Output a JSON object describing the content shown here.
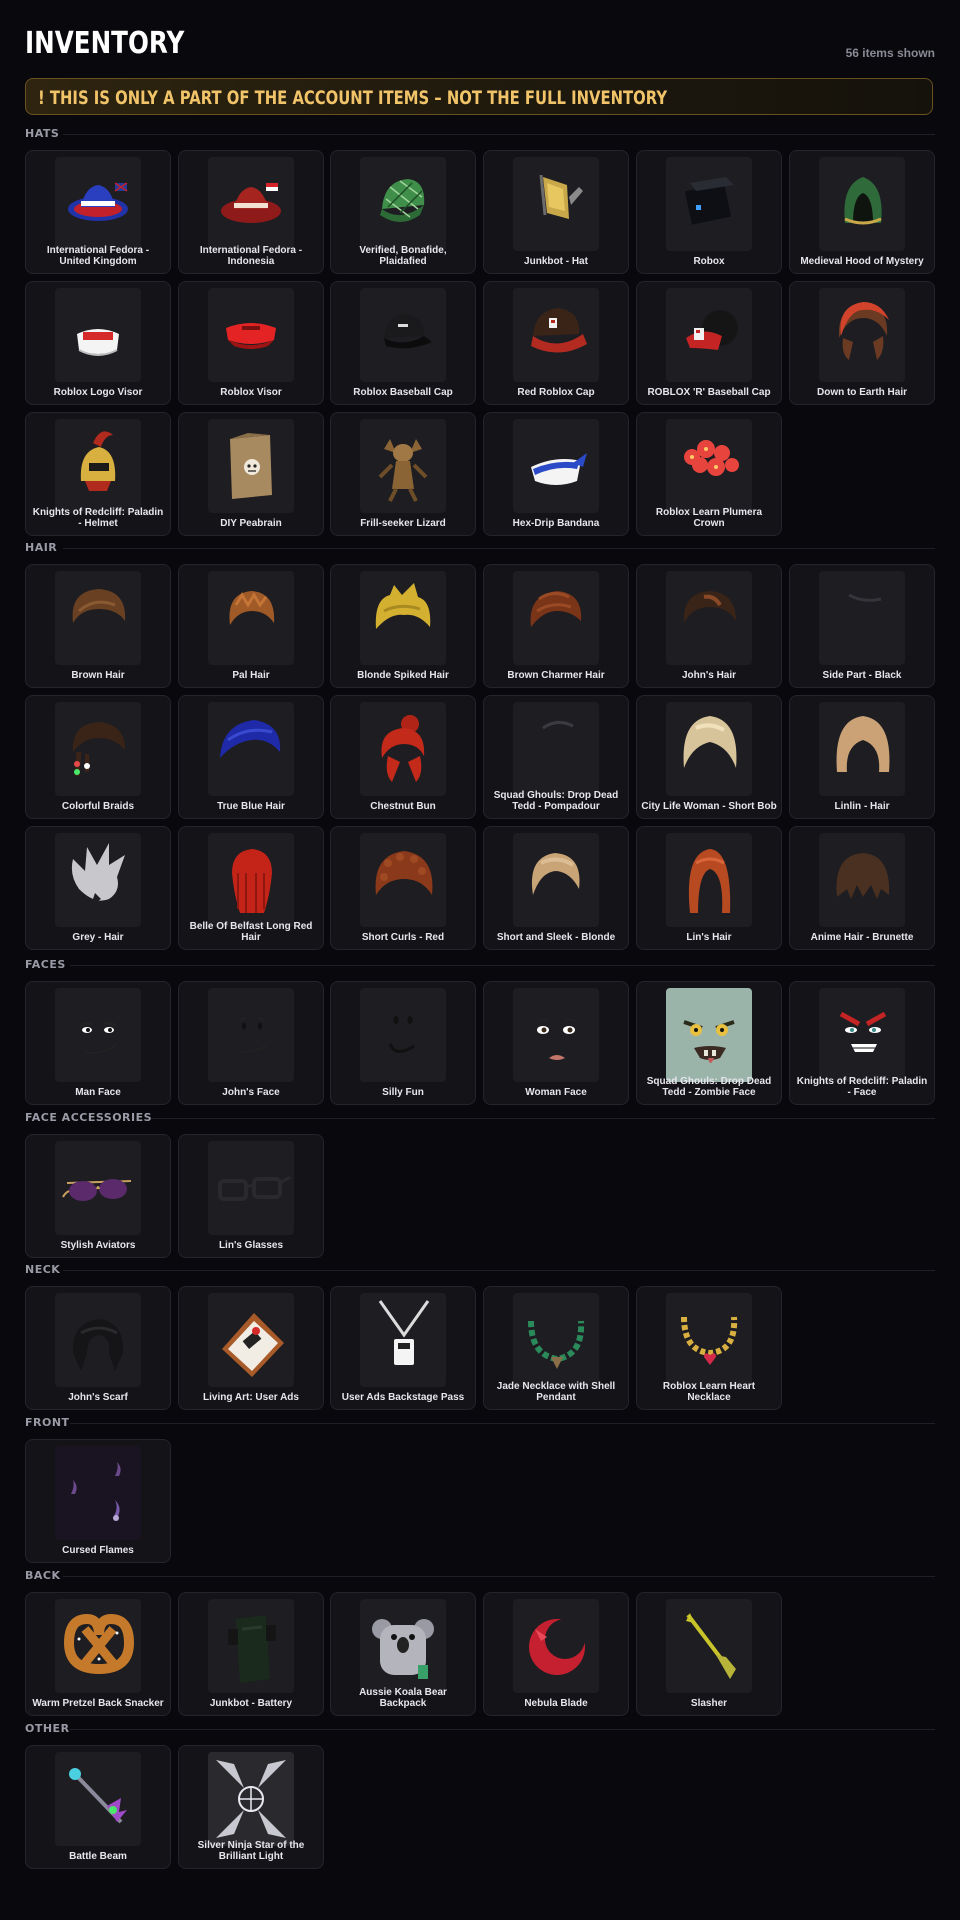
{
  "header": {
    "title": "INVENTORY",
    "count": "56 items shown"
  },
  "banner": {
    "text": "! THIS IS ONLY A PART OF THE ACCOUNT ITEMS – NOT THE FULL INVENTORY",
    "accent": "#f2c46a"
  },
  "sections": [
    {
      "label": "HATS",
      "items": [
        {
          "name": "International Fedora - United Kingdom",
          "icon": "fedora-uk"
        },
        {
          "name": "International Fedora - Indonesia",
          "icon": "fedora-indonesia"
        },
        {
          "name": "Verified, Bonafide, Plaidafied",
          "icon": "plaid-cap"
        },
        {
          "name": "Junkbot - Hat",
          "icon": "junkbot-hat"
        },
        {
          "name": "Robox",
          "icon": "robox"
        },
        {
          "name": "Medieval Hood of Mystery",
          "icon": "medieval-hood"
        },
        {
          "name": "Roblox Logo Visor",
          "icon": "white-visor"
        },
        {
          "name": "Roblox Visor",
          "icon": "red-visor"
        },
        {
          "name": "Roblox Baseball Cap",
          "icon": "black-cap"
        },
        {
          "name": "Red Roblox Cap",
          "icon": "red-cap"
        },
        {
          "name": "ROBLOX 'R' Baseball Cap",
          "icon": "r-cap"
        },
        {
          "name": "Down to Earth Hair",
          "icon": "down-to-earth-hair"
        },
        {
          "name": "Knights of Redcliff: Paladin - Helmet",
          "icon": "paladin-helmet"
        },
        {
          "name": "DIY Peabrain",
          "icon": "peabrain-box"
        },
        {
          "name": "Frill-seeker Lizard",
          "icon": "frill-lizard"
        },
        {
          "name": "Hex-Drip Bandana",
          "icon": "bandana"
        },
        {
          "name": "Roblox Learn Plumera Crown",
          "icon": "plumera-crown"
        }
      ]
    },
    {
      "label": "HAIR",
      "items": [
        {
          "name": "Brown Hair",
          "icon": "brown-hair"
        },
        {
          "name": "Pal Hair",
          "icon": "pal-hair"
        },
        {
          "name": "Blonde Spiked Hair",
          "icon": "blonde-spiked-hair"
        },
        {
          "name": "Brown Charmer Hair",
          "icon": "charmer-hair"
        },
        {
          "name": "John's Hair",
          "icon": "johns-hair"
        },
        {
          "name": "Side Part - Black",
          "icon": "side-part-hair"
        },
        {
          "name": "Colorful Braids",
          "icon": "colorful-braids"
        },
        {
          "name": "True Blue Hair",
          "icon": "blue-hair"
        },
        {
          "name": "Chestnut Bun",
          "icon": "chestnut-bun"
        },
        {
          "name": "Squad Ghouls: Drop Dead Tedd - Pompadour",
          "icon": "pompadour"
        },
        {
          "name": "City Life Woman - Short Bob",
          "icon": "short-bob"
        },
        {
          "name": "Linlin - Hair",
          "icon": "linlin-hair"
        },
        {
          "name": "Grey - Hair",
          "icon": "grey-hair"
        },
        {
          "name": "Belle Of Belfast Long Red Hair",
          "icon": "long-red-hair"
        },
        {
          "name": "Short Curls - Red",
          "icon": "short-curls"
        },
        {
          "name": "Short and Sleek - Blonde",
          "icon": "sleek-blonde"
        },
        {
          "name": "Lin's Hair",
          "icon": "lins-hair"
        },
        {
          "name": "Anime Hair - Brunette",
          "icon": "anime-hair"
        }
      ]
    },
    {
      "label": "FACES",
      "items": [
        {
          "name": "Man Face",
          "icon": "man-face"
        },
        {
          "name": "John's Face",
          "icon": "johns-face"
        },
        {
          "name": "Silly Fun",
          "icon": "silly-fun-face"
        },
        {
          "name": "Woman Face",
          "icon": "woman-face"
        },
        {
          "name": "Squad Ghouls: Drop Dead Tedd - Zombie Face",
          "icon": "zombie-face"
        },
        {
          "name": "Knights of Redcliff: Paladin - Face",
          "icon": "paladin-face"
        }
      ]
    },
    {
      "label": "FACE ACCESSORIES",
      "items": [
        {
          "name": "Stylish Aviators",
          "icon": "aviators"
        },
        {
          "name": "Lin's Glasses",
          "icon": "glasses"
        }
      ]
    },
    {
      "label": "NECK",
      "items": [
        {
          "name": "John's Scarf",
          "icon": "scarf"
        },
        {
          "name": "Living Art: User Ads",
          "icon": "user-ads-frame"
        },
        {
          "name": "User Ads Backstage Pass",
          "icon": "backstage-pass"
        },
        {
          "name": "Jade Necklace with Shell Pendant",
          "icon": "jade-necklace"
        },
        {
          "name": "Roblox Learn Heart Necklace",
          "icon": "heart-necklace"
        }
      ]
    },
    {
      "label": "FRONT",
      "items": [
        {
          "name": "Cursed Flames",
          "icon": "cursed-flames"
        }
      ]
    },
    {
      "label": "BACK",
      "items": [
        {
          "name": "Warm Pretzel Back Snacker",
          "icon": "pretzel"
        },
        {
          "name": "Junkbot - Battery",
          "icon": "battery"
        },
        {
          "name": "Aussie Koala Bear Backpack",
          "icon": "koala-backpack"
        },
        {
          "name": "Nebula Blade",
          "icon": "nebula-blade"
        },
        {
          "name": "Slasher",
          "icon": "slasher"
        }
      ]
    },
    {
      "label": "OTHER",
      "items": [
        {
          "name": "Battle Beam",
          "icon": "battle-beam"
        },
        {
          "name": "Silver Ninja Star of the Brilliant Light",
          "icon": "ninja-star"
        }
      ]
    }
  ]
}
